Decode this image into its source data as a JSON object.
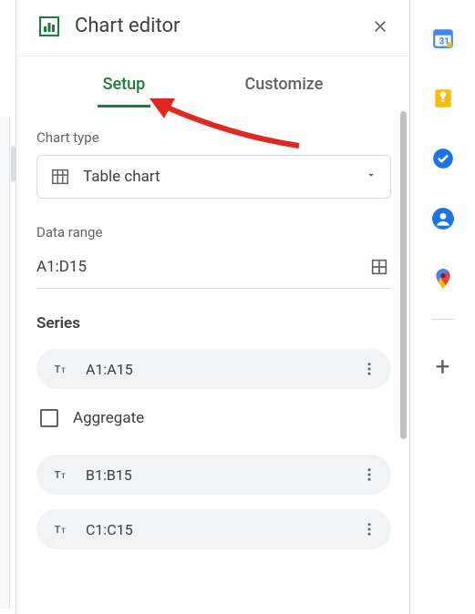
{
  "panel": {
    "title": "Chart editor",
    "tabs": {
      "setup": "Setup",
      "customize": "Customize",
      "active": "setup"
    }
  },
  "setup": {
    "chart_type": {
      "label": "Chart type",
      "value": "Table chart"
    },
    "data_range": {
      "label": "Data range",
      "value": "A1:D15"
    },
    "series": {
      "title": "Series",
      "items": [
        "A1:A15",
        "B1:B15",
        "C1:C15"
      ],
      "aggregate_label": "Aggregate",
      "aggregate_checked": false
    }
  },
  "sidebar_apps": [
    "calendar",
    "keep",
    "tasks",
    "contacts",
    "maps"
  ]
}
